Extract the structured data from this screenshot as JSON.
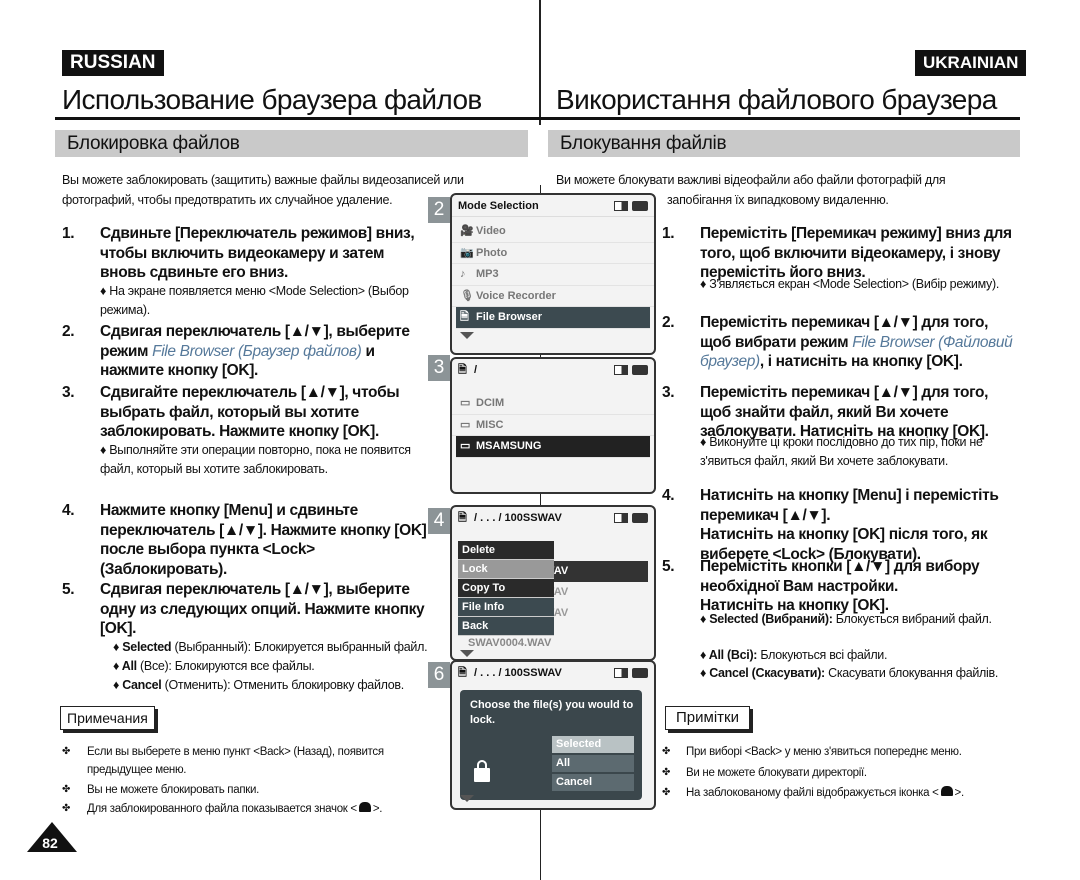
{
  "languages": {
    "left": "RUSSIAN",
    "right": "UKRAINIAN"
  },
  "titles": {
    "left": "Использование браузера файлов",
    "right": "Використання файлового браузера"
  },
  "sections": {
    "left": "Блокировка файлов",
    "right": "Блокування файлів"
  },
  "ru": {
    "intro": [
      "Вы можете заблокировать (защитить) важные файлы видеозаписей или",
      "фотографий, чтобы предотвратить их случайное удаление."
    ],
    "steps": [
      {
        "num": "1.",
        "text": "Сдвиньте [Переключатель режимов] вниз, чтобы включить видеокамеру и затем вновь сдвиньте его вниз.",
        "sub": "♦ На экране появляется меню <Mode Selection> (Выбор режима)."
      },
      {
        "num": "2.",
        "pre": "Сдвигая переключатель [▲/▼], выберите режим ",
        "em": "File Browser (Браузер файлов)",
        "post": " и нажмите кнопку [OK]."
      },
      {
        "num": "3.",
        "text": "Сдвигайте переключатель [▲/▼], чтобы выбрать файл, который вы хотите заблокировать. Нажмите кнопку [OK].",
        "sub": "♦ Выполняйте эти операции повторно, пока не появится файл, который вы хотите заблокировать."
      },
      {
        "num": "4.",
        "text": "Нажмите кнопку [Menu] и сдвиньте переключатель [▲/▼]. Нажмите кнопку [OK] после выбора пункта <Lock> (Заблокировать)."
      },
      {
        "num": "5.",
        "text": "Сдвигая переключатель [▲/▼], выберите одну из следующих опций. Нажмите кнопку [OK]."
      }
    ],
    "options": [
      {
        "key": "♦ Selected",
        "desc": " (Выбранный): Блокируется выбранный файл."
      },
      {
        "key": "♦ All",
        "desc": " (Все): Блокируются все файлы."
      },
      {
        "key": "♦ Cancel",
        "desc": " (Отменить): Отменить блокировку файлов."
      }
    ],
    "notes_label": "Примечания",
    "notes": [
      "Если вы выберете в меню пункт <Back> (Назад), появится предыдущее меню.",
      "Вы не можете блокировать папки.",
      "Для заблокированного файла показывается значок <",
      ">."
    ]
  },
  "uk": {
    "intro": [
      "Ви можете блокувати важливі відеофайли або файли фотографій для",
      "запобігання їх випадковому видаленню."
    ],
    "steps": [
      {
        "num": "1.",
        "text": "Перемістіть [Перемикач режиму] вниз для того, щоб включити відеокамеру, і знову перемістіть його вниз.",
        "sub": "♦ З'являється екран <Mode Selection> (Вибір режиму)."
      },
      {
        "num": "2.",
        "pre": "Перемістіть перемикач [▲/▼] для того, щоб вибрати режим ",
        "em": "File Browser (Файловий браузер)",
        "post": ", і натисніть на кнопку [OK]."
      },
      {
        "num": "3.",
        "text": "Перемістіть перемикач [▲/▼] для того, щоб знайти файл, який Ви хочете заблокувати. Натисніть на кнопку [OK].",
        "sub": "♦ Виконуйте ці кроки послідовно до тих пір, поки не з'явиться файл, який Ви хочете заблокувати."
      },
      {
        "num": "4.",
        "text": "Натисніть на кнопку [Menu] і перемістіть перемикач [▲/▼].",
        "text2": "Натисніть на кнопку [OK] після того, як виберете <Lock> (Блокувати)."
      },
      {
        "num": "5.",
        "text": "Перемістіть кнопки [▲/▼] для вибору необхідної Вам настройки.",
        "text2": "Натисніть на кнопку [OK]."
      }
    ],
    "options": [
      {
        "key": "♦ Selected (Вибраний):",
        "desc": " Блокується вибраний файл."
      },
      {
        "key": "♦ All (Всі):",
        "desc": " Блокуються всі файли."
      },
      {
        "key": "♦ Cancel (Скасувати):",
        "desc": " Скасувати блокування файлів."
      }
    ],
    "notes_label": "Примітки",
    "notes": [
      "При виборі <Back> у меню з'явиться попереднє меню.",
      "Ви не можете блокувати директорії.",
      "На заблокованому файлі відображується іконка <",
      ">."
    ]
  },
  "screens": {
    "s2": {
      "label": "2",
      "title": "Mode Selection",
      "items": [
        "Video",
        "Photo",
        "MP3",
        "Voice Recorder",
        "File Browser"
      ],
      "selected": "File Browser"
    },
    "s3": {
      "label": "3",
      "title": "/",
      "items": [
        "DCIM",
        "MISC",
        "MSAMSUNG"
      ],
      "selected": "MSAMSUNG"
    },
    "s4": {
      "label": "4",
      "title": "/ . . . / 100SSWAV",
      "files": [
        "el",
        "WAV",
        "WAV",
        "WAV",
        "SWAV0004.WAV"
      ],
      "menu": [
        "Delete",
        "Lock",
        "Copy To",
        "File Info",
        "Back"
      ]
    },
    "s6": {
      "label": "6",
      "title": "/ . . . / 100SSWAV",
      "message": "Choose the file(s) you would to lock.",
      "options": [
        "Selected",
        "All",
        "Cancel"
      ]
    }
  },
  "page_number": "82",
  "colors": {
    "accent_italic": "#56799a",
    "highlight": "#3c4a50",
    "section_bar": "#c9c9c9"
  }
}
